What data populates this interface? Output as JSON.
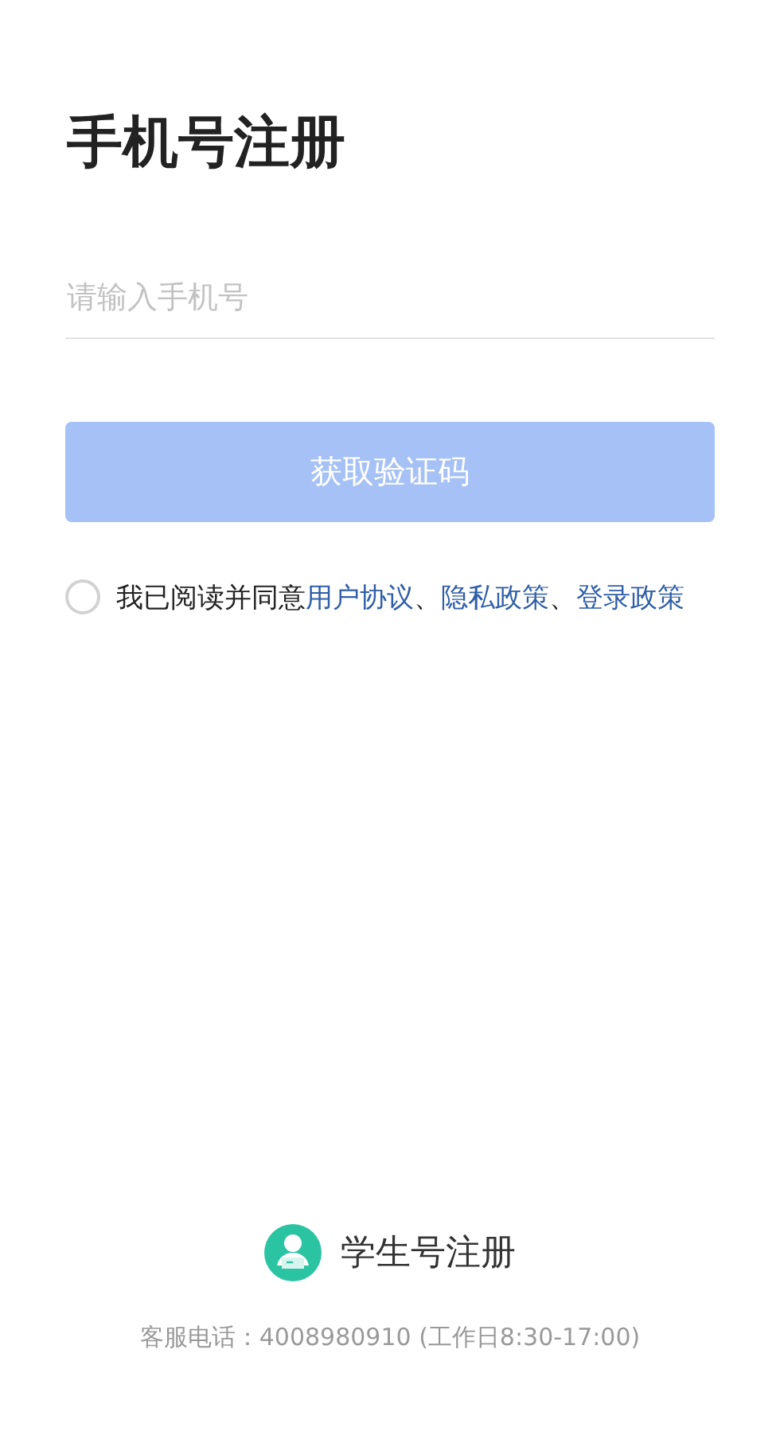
{
  "title": "手机号注册",
  "phone_field": {
    "placeholder": "请输入手机号"
  },
  "code_button": {
    "label": "获取验证码",
    "disabled": true
  },
  "agreement": {
    "checked": false,
    "parts": [
      {
        "kind": "plain",
        "text": "我已阅读并同意"
      },
      {
        "kind": "link",
        "text": "用户协议"
      },
      {
        "kind": "plain",
        "text": "、"
      },
      {
        "kind": "link",
        "text": "隐私政策"
      },
      {
        "kind": "plain",
        "text": "、"
      },
      {
        "kind": "link",
        "text": "登录政策"
      }
    ]
  },
  "student_register": {
    "label": "学生号注册"
  },
  "hotline": "客服电话：4008980910 (工作日8:30-17:00)"
}
